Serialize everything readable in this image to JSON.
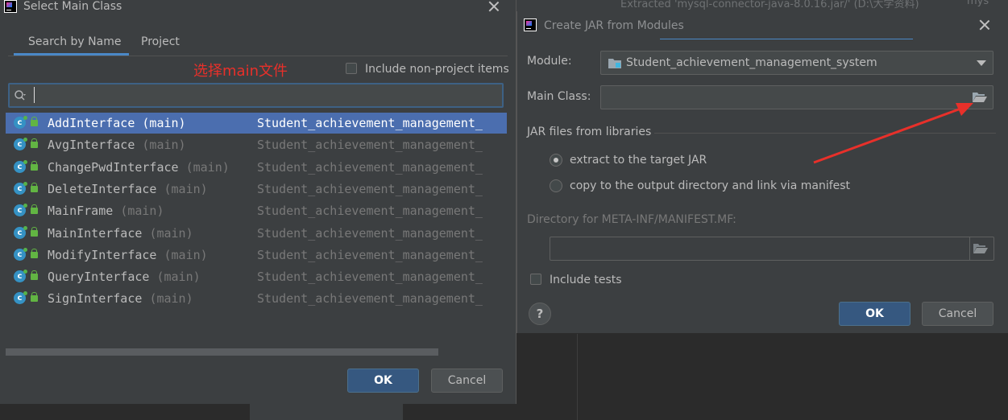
{
  "background": {
    "top_text": "Extracted 'mysql-connector-java-8.0.16.jar/' (D:\\大学资料)",
    "top_text_right": "mys"
  },
  "select_dialog": {
    "title": "Select Main Class",
    "tabs": [
      {
        "label": "Search by Name",
        "active": true
      },
      {
        "label": "Project",
        "active": false
      }
    ],
    "annotation": "选择main文件",
    "include_non_project": {
      "label": "Include non-project items",
      "checked": false
    },
    "search": {
      "value": "",
      "placeholder": ""
    },
    "items": [
      {
        "name": "AddInterface",
        "suffix": "(main)",
        "module": "Student_achievement_management_",
        "selected": true
      },
      {
        "name": "AvgInterface",
        "suffix": "(main)",
        "module": "Student_achievement_management_",
        "selected": false
      },
      {
        "name": "ChangePwdInterface",
        "suffix": "(main)",
        "module": "Student_achievement_management_",
        "selected": false
      },
      {
        "name": "DeleteInterface",
        "suffix": "(main)",
        "module": "Student_achievement_management_",
        "selected": false
      },
      {
        "name": "MainFrame",
        "suffix": "(main)",
        "module": "Student_achievement_management_",
        "selected": false
      },
      {
        "name": "MainInterface",
        "suffix": "(main)",
        "module": "Student_achievement_management_",
        "selected": false
      },
      {
        "name": "ModifyInterface",
        "suffix": "(main)",
        "module": "Student_achievement_management_",
        "selected": false
      },
      {
        "name": "QueryInterface",
        "suffix": "(main)",
        "module": "Student_achievement_management_",
        "selected": false
      },
      {
        "name": "SignInterface",
        "suffix": "(main)",
        "module": "Student_achievement_management_",
        "selected": false
      }
    ],
    "ok_label": "OK",
    "cancel_label": "Cancel"
  },
  "jar_dialog": {
    "title": "Create JAR from Modules",
    "module_label": "Module:",
    "module_value": "Student_achievement_management_system",
    "main_class_label": "Main Class:",
    "main_class_value": "",
    "jar_files_label": "JAR files from libraries",
    "options": [
      {
        "label": "extract to the target JAR",
        "selected": true
      },
      {
        "label": "copy to the output directory and link via manifest",
        "selected": false
      }
    ],
    "manifest_dir_label": "Directory for META-INF/MANIFEST.MF:",
    "manifest_dir_value": "",
    "include_tests": {
      "label": "Include tests",
      "checked": false
    },
    "help_label": "?",
    "ok_label": "OK",
    "cancel_label": "Cancel"
  },
  "colors": {
    "dialog_bg": "#3c3f41",
    "selection": "#4b6eaf",
    "primary_button": "#365880",
    "annotation": "#e8302a"
  },
  "icons": [
    "intellij-app-icon",
    "close-icon",
    "search-icon",
    "class-icon",
    "lock-icon",
    "folder-icon",
    "open-folder-icon",
    "help-icon"
  ]
}
